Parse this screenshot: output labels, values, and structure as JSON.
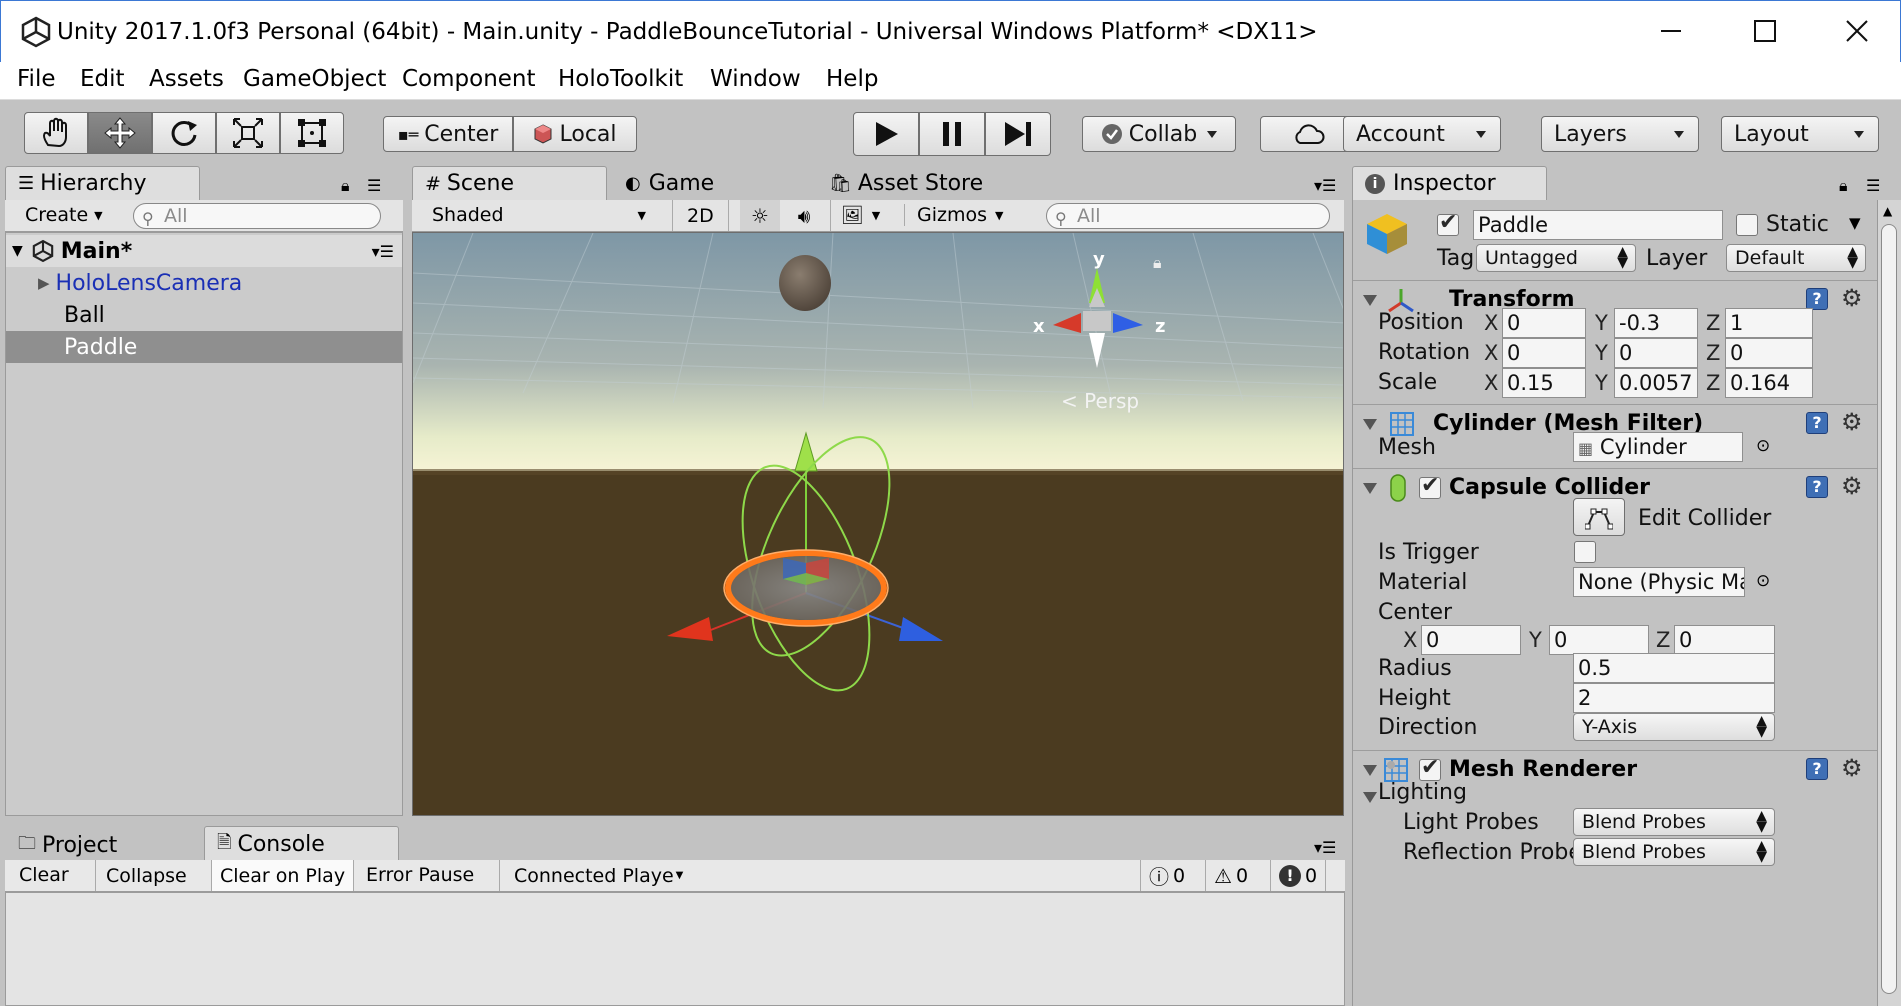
{
  "window": {
    "title": "Unity 2017.1.0f3 Personal (64bit) - Main.unity - PaddleBounceTutorial - Universal Windows Platform* <DX11>"
  },
  "menu": [
    "File",
    "Edit",
    "Assets",
    "GameObject",
    "Component",
    "HoloToolkit",
    "Window",
    "Help"
  ],
  "toolbar": {
    "tools": [
      "hand-tool-icon",
      "move-tool-icon",
      "rotate-tool-icon",
      "scale-tool-icon",
      "rect-tool-icon"
    ],
    "pivot": "Center",
    "space": "Local",
    "collab": "Collab",
    "account": "Account",
    "layers": "Layers",
    "layout": "Layout"
  },
  "hierarchy": {
    "tab": "Hierarchy",
    "create": "Create",
    "search_placeholder": "All",
    "scene": "Main*",
    "items": [
      {
        "label": "HoloLensCamera",
        "color": "#1a2fb5"
      },
      {
        "label": "Ball"
      },
      {
        "label": "Paddle",
        "selected": true
      }
    ]
  },
  "scene": {
    "tabs": [
      "Scene",
      "Game",
      "Asset Store"
    ],
    "shading": "Shaded",
    "mode_2d": "2D",
    "gizmos": "Gizmos",
    "search_placeholder": "All",
    "persp": "Persp",
    "gizmo_axes": {
      "x": "x",
      "y": "y",
      "z": "z"
    }
  },
  "bottom": {
    "tabs": [
      "Project",
      "Console"
    ],
    "buttons": [
      "Clear",
      "Collapse",
      "Clear on Play",
      "Error Pause",
      "Connected Playe"
    ],
    "counts": {
      "info": "0",
      "warnings": "0",
      "errors": "0"
    }
  },
  "inspector": {
    "tab": "Inspector",
    "name": "Paddle",
    "static_label": "Static",
    "tag_label": "Tag",
    "tag": "Untagged",
    "layer_label": "Layer",
    "layer": "Default",
    "transform": {
      "title": "Transform",
      "position_label": "Position",
      "rotation_label": "Rotation",
      "scale_label": "Scale",
      "position": {
        "x": "0",
        "y": "-0.3",
        "z": "1"
      },
      "rotation": {
        "x": "0",
        "y": "0",
        "z": "0"
      },
      "scale": {
        "x": "0.15",
        "y": "0.0057",
        "z": "0.164"
      }
    },
    "mesh_filter": {
      "title": "Cylinder (Mesh Filter)",
      "mesh_label": "Mesh",
      "mesh": "Cylinder"
    },
    "capsule": {
      "title": "Capsule Collider",
      "edit_label": "Edit Collider",
      "is_trigger_label": "Is Trigger",
      "material_label": "Material",
      "material": "None (Physic Mate",
      "center_label": "Center",
      "center": {
        "x": "0",
        "y": "0",
        "z": "0"
      },
      "radius_label": "Radius",
      "radius": "0.5",
      "height_label": "Height",
      "height": "2",
      "direction_label": "Direction",
      "direction": "Y-Axis"
    },
    "mesh_renderer": {
      "title": "Mesh Renderer",
      "lighting_label": "Lighting",
      "light_probes_label": "Light Probes",
      "light_probes": "Blend Probes",
      "reflection_probes_label": "Reflection Probes",
      "reflection_probes": "Blend Probes"
    }
  }
}
